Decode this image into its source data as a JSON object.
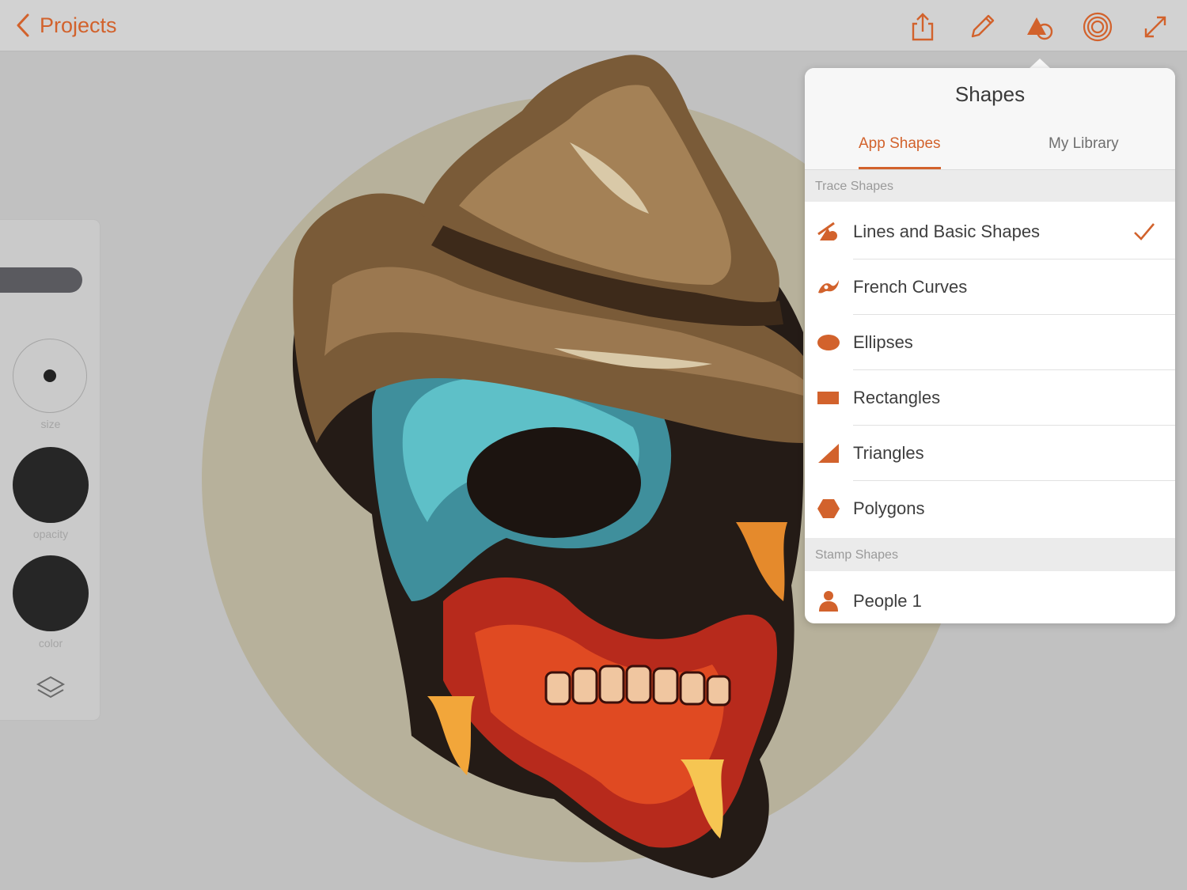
{
  "header": {
    "back_label": "Projects",
    "toolbar_icons": [
      "share-icon",
      "pencil-icon",
      "shapes-icon",
      "brush-rings-icon",
      "fullscreen-icon"
    ]
  },
  "palette": {
    "size_label": "size",
    "opacity_label": "opacity",
    "color_label": "color"
  },
  "shapes_panel": {
    "title": "Shapes",
    "tabs": [
      {
        "label": "App Shapes",
        "active": true
      },
      {
        "label": "My Library",
        "active": false
      }
    ],
    "trace_header": "Trace Shapes",
    "trace_items": [
      {
        "label": "Lines and Basic Shapes",
        "icon": "lines-basic-shapes-icon",
        "checked": true
      },
      {
        "label": "French Curves",
        "icon": "french-curve-icon",
        "checked": false
      },
      {
        "label": "Ellipses",
        "icon": "ellipse-icon",
        "checked": false
      },
      {
        "label": "Rectangles",
        "icon": "rectangle-icon",
        "checked": false
      },
      {
        "label": "Triangles",
        "icon": "triangle-icon",
        "checked": false
      },
      {
        "label": "Polygons",
        "icon": "polygon-icon",
        "checked": false
      }
    ],
    "stamp_header": "Stamp Shapes",
    "stamp_items": [
      {
        "label": "People 1",
        "icon": "person-icon"
      }
    ]
  },
  "colors": {
    "accent": "#d2622c",
    "toolbar_bg": "#d2d2d2",
    "canvas_bg": "#c1c1c1",
    "art_circle": "#b7b19b"
  }
}
